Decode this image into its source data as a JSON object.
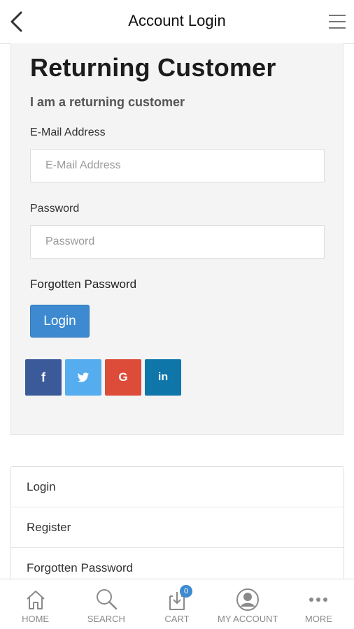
{
  "header": {
    "title": "Account Login"
  },
  "login": {
    "heading": "Returning Customer",
    "subheading": "I am a returning customer",
    "email_label": "E-Mail Address",
    "email_placeholder": "E-Mail Address",
    "email_value": "",
    "password_label": "Password",
    "password_placeholder": "Password",
    "password_value": "",
    "forgot_link": "Forgotten Password",
    "login_button": "Login",
    "social": [
      {
        "icon": "facebook-icon",
        "glyph": "f",
        "color": "#3b5a9a"
      },
      {
        "icon": "twitter-icon",
        "glyph": "t",
        "color": "#55acee"
      },
      {
        "icon": "google-icon",
        "glyph": "G",
        "color": "#dd4b39"
      },
      {
        "icon": "linkedin-icon",
        "glyph": "in",
        "color": "#0e76a8"
      }
    ]
  },
  "links": {
    "items": [
      "Login",
      "Register",
      "Forgotten Password"
    ]
  },
  "bottom_nav": {
    "items": [
      {
        "label": "HOME",
        "icon": "home-icon"
      },
      {
        "label": "SEARCH",
        "icon": "search-icon"
      },
      {
        "label": "CART",
        "icon": "cart-icon",
        "badge": "0"
      },
      {
        "label": "MY ACCOUNT",
        "icon": "account-icon"
      },
      {
        "label": "MORE",
        "icon": "more-icon"
      }
    ]
  },
  "colors": {
    "accent": "#3d8ad0",
    "panel_bg": "#f4f4f4"
  }
}
